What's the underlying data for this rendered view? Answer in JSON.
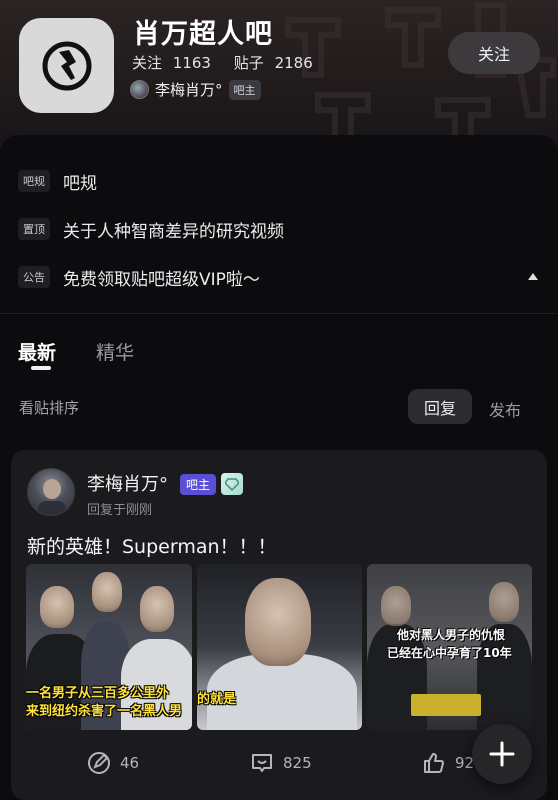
{
  "header": {
    "forum_title": "肖万超人吧",
    "follow_label": "关注",
    "follow_count": "1163",
    "posts_label": "贴子",
    "posts_count": "2186",
    "owner_name": "李梅肖万°",
    "owner_badge": "吧主",
    "follow_button": "关注"
  },
  "notices": [
    {
      "tag": "吧规",
      "text": "吧规"
    },
    {
      "tag": "置顶",
      "text": "关于人种智商差异的研究视频"
    },
    {
      "tag": "公告",
      "text": "免费领取贴吧超级VIP啦～"
    }
  ],
  "tabs": {
    "latest": "最新",
    "featured": "精华"
  },
  "sort": {
    "label": "看贴排序",
    "reply": "回复",
    "publish": "发布"
  },
  "post": {
    "author": "李梅肖万°",
    "badge": "吧主",
    "meta": "回复于刚刚",
    "text": "新的英雄！Superman！！！",
    "thumb1_caption_line1": "一名男子从三百多公里外",
    "thumb1_caption_line2": "来到纽约杀害了一名黑人男",
    "thumb2_caption": "的就是",
    "thumb3_caption_line1": "他对黑人男子的仇恨",
    "thumb3_caption_line2": "已经在心中孕育了10年",
    "edit_count": "46",
    "comment_count": "825",
    "like_count": "92"
  },
  "icons": [
    "forum-logo-icon",
    "collapse-icon",
    "level-diamond-icon",
    "edit-icon",
    "comment-icon",
    "like-icon",
    "plus-icon"
  ],
  "colors": {
    "badge_purple": "#5b4fd6",
    "background": "#0c0c0e",
    "card": "#1b1b1e",
    "caption_yellow": "#ffe23a"
  }
}
